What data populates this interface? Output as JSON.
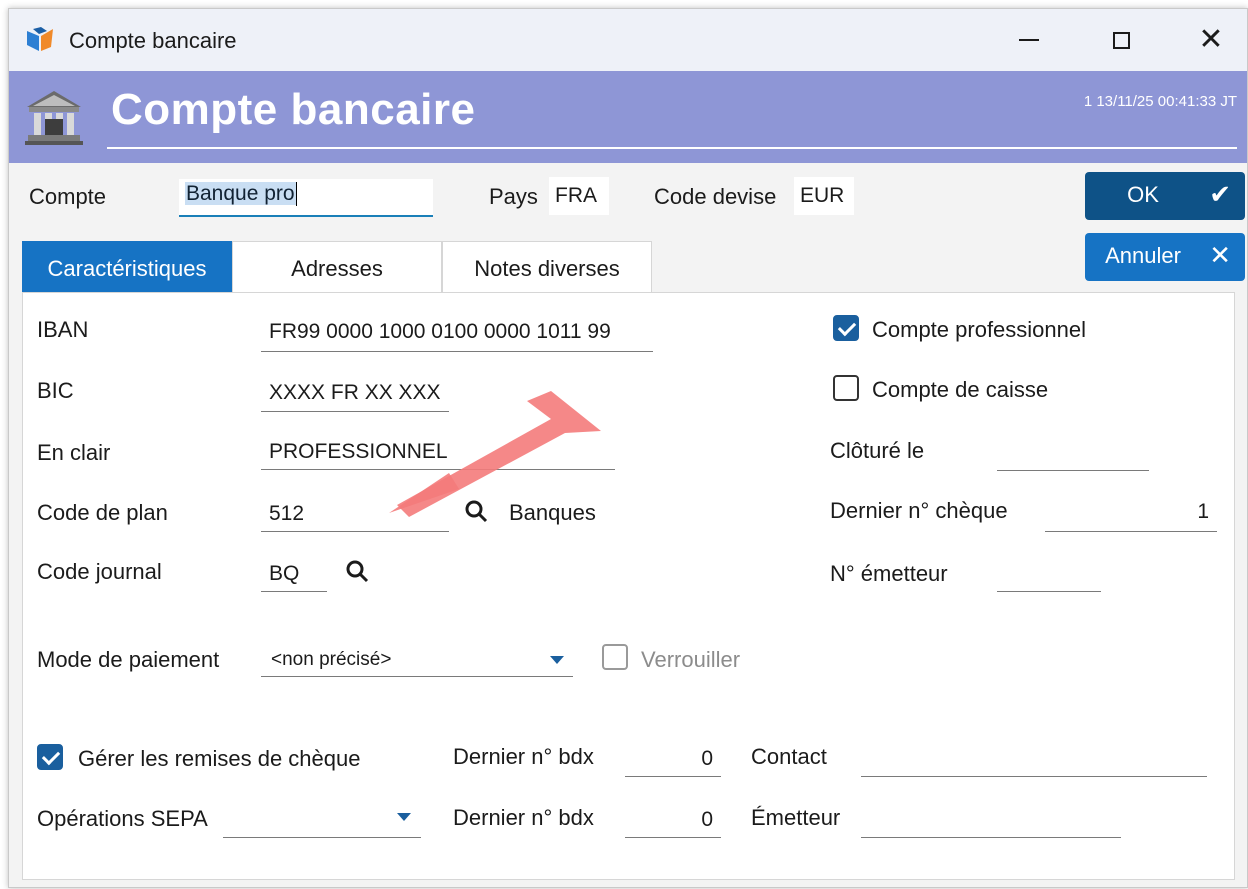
{
  "window": {
    "title": "Compte bancaire",
    "controls": {
      "minimize": "minimize",
      "maximize": "maximize",
      "close": "✕"
    }
  },
  "header": {
    "title": "Compte bancaire",
    "meta": "1  13/11/25 00:41:33  JT"
  },
  "top": {
    "compte_label": "Compte",
    "compte_value": "Banque pro",
    "pays_label": "Pays",
    "pays_value": "FRA",
    "devise_label": "Code devise",
    "devise_value": "EUR"
  },
  "buttons": {
    "ok_label": "OK",
    "ok_icon": "✔",
    "cancel_label": "Annuler",
    "cancel_icon": "✕"
  },
  "tabs": [
    {
      "label": "Caractéristiques",
      "active": true
    },
    {
      "label": "Adresses",
      "active": false
    },
    {
      "label": "Notes diverses",
      "active": false
    }
  ],
  "form": {
    "iban_label": "IBAN",
    "iban_value": "FR99 0000 1000 0100 0000 1011 99",
    "bic_label": "BIC",
    "bic_value": "XXXX FR XX XXX",
    "enclair_label": "En clair",
    "enclair_value": "PROFESSIONNEL",
    "codeplan_label": "Code de plan",
    "codeplan_value": "512",
    "codeplan_desc": "Banques",
    "codejournal_label": "Code journal",
    "codejournal_value": "BQ",
    "modepaiement_label": "Mode de paiement",
    "modepaiement_value": "<non précisé>",
    "verrouiller_label": "Verrouiller",
    "compte_pro_label": "Compte professionnel",
    "compte_pro_checked": true,
    "compte_caisse_label": "Compte de caisse",
    "compte_caisse_checked": false,
    "cloture_label": "Clôturé le",
    "cloture_value": "",
    "dernier_cheque_label": "Dernier n° chèque",
    "dernier_cheque_value": "1",
    "emetteur_num_label": "N° émetteur",
    "emetteur_num_value": "",
    "remises_label": "Gérer les remises de chèque",
    "remises_checked": true,
    "bdx1_label": "Dernier n° bdx",
    "bdx1_value": "0",
    "contact_label": "Contact",
    "contact_value": "",
    "sepa_label": "Opérations SEPA",
    "sepa_value": "",
    "bdx2_label": "Dernier n° bdx",
    "bdx2_value": "0",
    "emetteur_label": "Émetteur",
    "emetteur_value": ""
  },
  "colors": {
    "header_band": "#8e96d6",
    "ok_button": "#0e5287",
    "accent_blue": "#1673c4",
    "annotation_arrow": "#f47b7b"
  }
}
